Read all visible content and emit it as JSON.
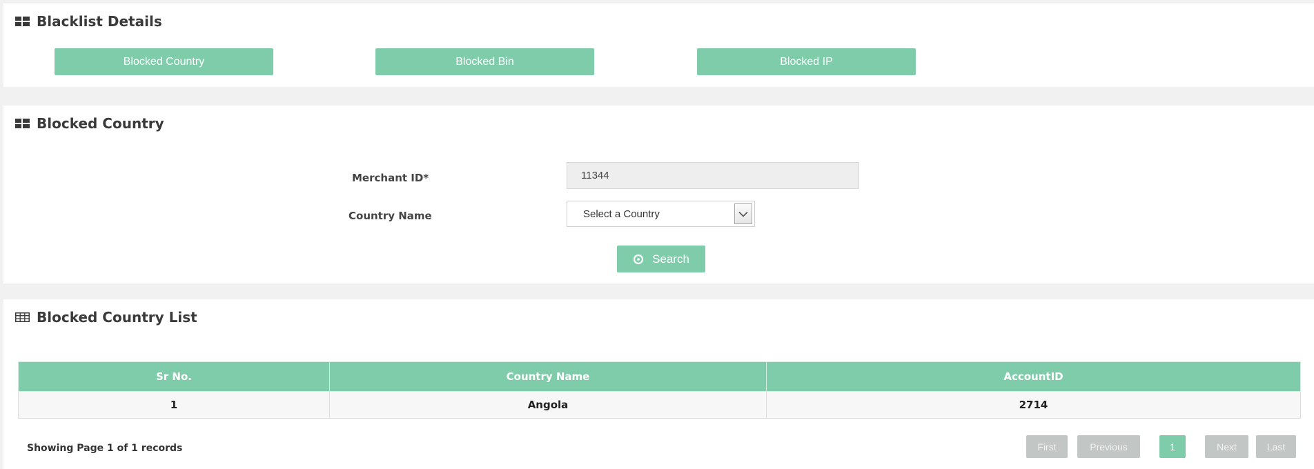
{
  "blacklist_panel": {
    "title": "Blacklist Details",
    "tabs": [
      {
        "label": "Blocked Country"
      },
      {
        "label": "Blocked Bin"
      },
      {
        "label": "Blocked IP"
      }
    ]
  },
  "search_panel": {
    "title": "Blocked Country",
    "merchant_label": "Merchant ID*",
    "merchant_value": "11344",
    "country_label": "Country Name",
    "country_selected": "Select a Country",
    "search_label": "Search"
  },
  "list_panel": {
    "title": "Blocked Country List",
    "columns": [
      "Sr No.",
      "Country Name",
      "AccountID"
    ],
    "rows": [
      {
        "sr": "1",
        "country": "Angola",
        "account_id": "2714"
      }
    ],
    "records_text": "Showing Page 1 of 1 records",
    "pagination": {
      "first": "First",
      "previous": "Previous",
      "current": "1",
      "next": "Next",
      "last": "Last"
    }
  },
  "colors": {
    "accent": "#7fccaa",
    "disabled": "#c2c7c5",
    "page_bg": "#f1f1f1"
  }
}
